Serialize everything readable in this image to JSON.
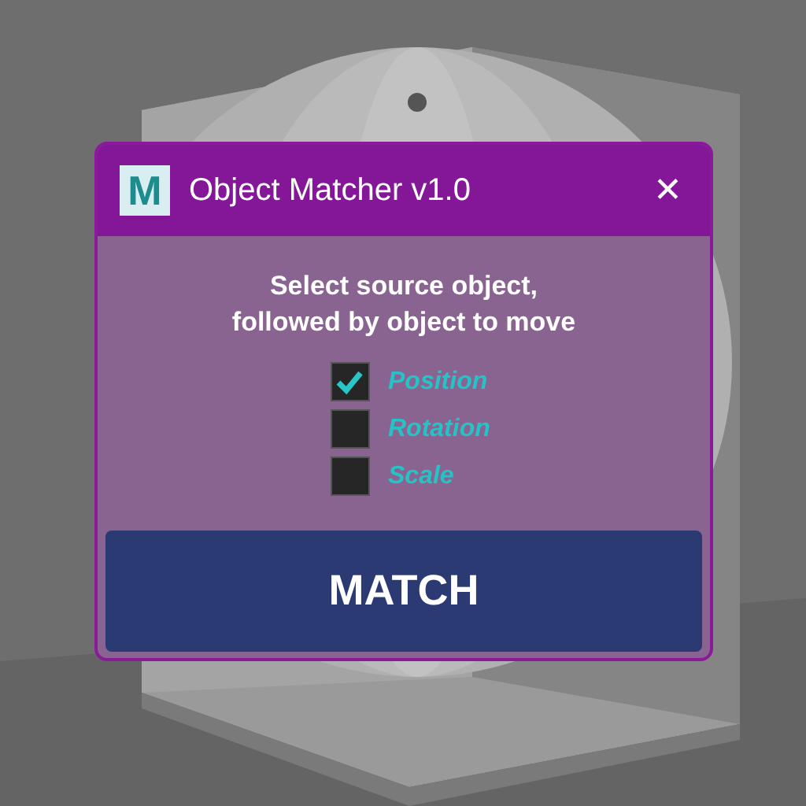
{
  "window": {
    "logo_text": "M",
    "title": "Object Matcher v1.0",
    "close": "✕"
  },
  "instruction": [
    "Select source object,",
    "followed by object to move"
  ],
  "options": [
    {
      "label": "Position",
      "checked": true
    },
    {
      "label": "Rotation",
      "checked": false
    },
    {
      "label": "Scale",
      "checked": false
    }
  ],
  "button": "MATCH"
}
